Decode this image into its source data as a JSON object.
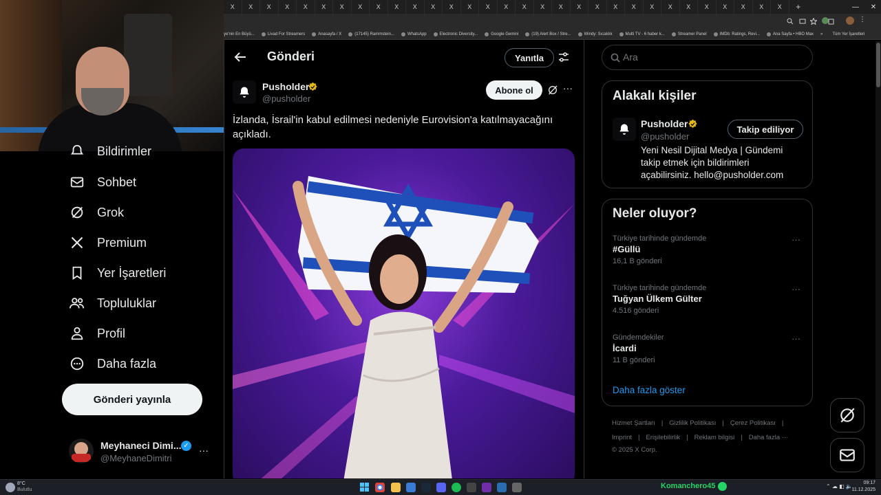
{
  "browser": {
    "tabs": [
      "X",
      "X",
      "X",
      "X",
      "X",
      "X",
      "X",
      "X",
      "X",
      "X",
      "X",
      "X",
      "X",
      "X",
      "X",
      "X",
      "X",
      "X",
      "X",
      "X",
      "X",
      "X",
      "X",
      "X",
      "X",
      "X",
      "X",
      "X",
      "X",
      "X",
      "X"
    ],
    "new_tab": "+",
    "bookmarks": [
      "ye'nin En Büyü...",
      "Livad For Streamers",
      "Anasayfa / X",
      "(17145) Rammstein...",
      "WhatsApp",
      "Electronic Diversity...",
      "Google Gemini",
      "(19) Alert Box / Stre...",
      "Windy: Sıcaklık",
      "Multi TV - 6 haber k...",
      "Streamer Panel",
      "IMDb: Ratings, Revi...",
      "Ana Sayfa • HBO Max"
    ],
    "bookmarks_overflow": "»",
    "all_bookmarks": "Tüm Yer İşaretleri"
  },
  "sidebar": {
    "items": [
      {
        "label": "Bildirimler",
        "icon": "bell-icon"
      },
      {
        "label": "Sohbet",
        "icon": "mail-icon"
      },
      {
        "label": "Grok",
        "icon": "grok-icon"
      },
      {
        "label": "Premium",
        "icon": "x-logo-icon"
      },
      {
        "label": "Yer İşaretleri",
        "icon": "bookmark-icon"
      },
      {
        "label": "Topluluklar",
        "icon": "communities-icon"
      },
      {
        "label": "Profil",
        "icon": "person-icon"
      },
      {
        "label": "Daha fazla",
        "icon": "more-circle-icon"
      }
    ],
    "post_button": "Gönderi yayınla",
    "account": {
      "name": "Meyhaneci Dimi...",
      "handle": "@MeyhaneDimitri",
      "more": "···"
    }
  },
  "post": {
    "header_title": "Gönderi",
    "reply_button": "Yanıtla",
    "author_name": "Pusholder",
    "author_handle": "@pusholder",
    "subscribe_button": "Abone ol",
    "more": "···",
    "text": "İzlanda, İsrail'in kabul edilmesi nedeniyle Eurovision'a katılmayacağını açıkladı."
  },
  "search": {
    "placeholder": "Ara"
  },
  "related": {
    "title": "Alakalı kişiler",
    "name": "Pusholder",
    "handle": "@pusholder",
    "follow_button": "Takip ediliyor",
    "bio": "Yeni Nesil Dijital Medya | Gündemi takip etmek için bildirimleri açabilirsiniz. hello@pusholder.com"
  },
  "trends": {
    "title": "Neler oluyor?",
    "items": [
      {
        "meta": "Türkiye tarihinde gündemde",
        "name": "#Güllü",
        "count": "16,1 B gönderi"
      },
      {
        "meta": "Türkiye tarihinde gündemde",
        "name": "Tuğyan Ülkem Gülter",
        "count": "4.516 gönderi"
      },
      {
        "meta": "Gündemdekiler",
        "name": "İcardi",
        "count": "11 B gönderi"
      }
    ],
    "show_more": "Daha fazla göster",
    "more": "···"
  },
  "footer": {
    "row1": [
      "Hizmet Şartları",
      "|",
      "Gizlilik Politikası",
      "|",
      "Çerez Politikası",
      "|"
    ],
    "row2": [
      "Imprint",
      "|",
      "Erişilebilirlik",
      "|",
      "Reklam bilgisi",
      "|",
      "Daha fazla ···"
    ],
    "copyright": "© 2025 X Corp."
  },
  "taskbar": {
    "weather_temp": "8°C",
    "weather_desc": "Bulutlu",
    "streamer": "Komanchero45",
    "time": "09:17",
    "date": "11.12.2025"
  },
  "colors": {
    "accent": "#1d9bf0",
    "verified_gold": "#e2b719",
    "background": "#000000",
    "border": "#2f3336",
    "whatsapp_green": "#25d366"
  }
}
